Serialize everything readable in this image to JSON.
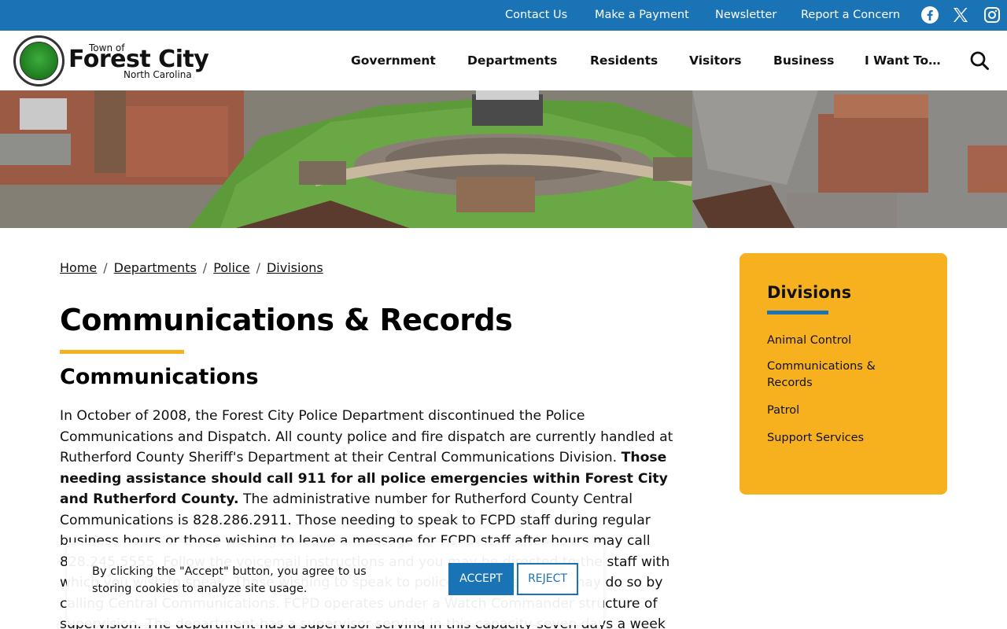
{
  "utility": {
    "links": [
      "Contact Us",
      "Make a Payment",
      "Newsletter",
      "Report a Concern"
    ],
    "social": [
      "facebook-icon",
      "x-icon",
      "instagram-icon"
    ]
  },
  "logo": {
    "top": "Town of",
    "main": "Forest City",
    "bottom": "North Carolina"
  },
  "nav": {
    "items": [
      "Government",
      "Departments",
      "Residents",
      "Visitors",
      "Business",
      "I Want To…"
    ]
  },
  "breadcrumb": [
    "Home",
    "Departments",
    "Police",
    "Divisions"
  ],
  "page": {
    "title": "Communications & Records",
    "section_heading": "Communications",
    "para_1": "In October of 2008, the Forest City Police Department discontinued the Police Communications and Dispatch. All county police and fire dispatch are currently handled at Rutherford County Sheriff's Department at their Central Communications Division.",
    "para_bold": "Those needing assistance should call 911 for all police emergencies within Forest City and Rutherford County.",
    "para_2": "The administrative number for Rutherford County Central Communications is 828.286.2911. Those needing to speak to FCPD staff during regular business hours or those wishing to leave a message for FCPD staff after hours may call 828.245.5555. Follow the voicemail instructions and you may be directed to the staff with which you wish to speak. Those wishing to speak to police staff after hours may do so by calling Central Communications. FCPD operates under a Watch Commander structure of supervision. The department has a supervisor serving in this capacity seven days a week"
  },
  "sidebar": {
    "title": "Divisions",
    "links": [
      "Animal Control",
      "Communications & Records",
      "Patrol",
      "Support Services"
    ]
  },
  "cookie": {
    "text": "By clicking the \"Accept\" button, you agree to us storing cookies to analyze site usage.",
    "accept": "ACCEPT",
    "reject": "REJECT"
  },
  "colors": {
    "brand_blue": "#1a73b5",
    "accent_gold": "#f7b11f"
  }
}
